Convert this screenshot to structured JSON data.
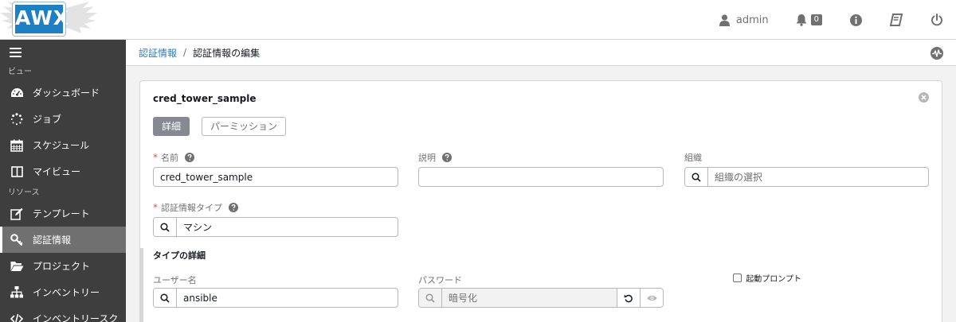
{
  "header": {
    "logo_text": "AWX",
    "user": "admin",
    "notification_count": "0"
  },
  "sidebar": {
    "section_views": "ビュー",
    "section_resources": "リソース",
    "items": [
      {
        "label": "ダッシュボード",
        "icon": "dashboard-icon"
      },
      {
        "label": "ジョブ",
        "icon": "jobs-spinner-icon"
      },
      {
        "label": "スケジュール",
        "icon": "calendar-icon"
      },
      {
        "label": "マイビュー",
        "icon": "columns-icon"
      },
      {
        "label": "テンプレート",
        "icon": "edit-icon"
      },
      {
        "label": "認証情報",
        "icon": "key-icon",
        "active": true
      },
      {
        "label": "プロジェクト",
        "icon": "folder-icon"
      },
      {
        "label": "インベントリー",
        "icon": "sitemap-icon"
      },
      {
        "label": "インベントリースク",
        "icon": "code-icon"
      }
    ]
  },
  "breadcrumb": {
    "parent": "認証情報",
    "separator": "/",
    "current": "認証情報の編集"
  },
  "panel": {
    "title": "cred_tower_sample",
    "tabs": [
      {
        "label": "詳細",
        "active": true
      },
      {
        "label": "パーミッション",
        "active": false
      }
    ],
    "fields": {
      "name_label": "名前",
      "name_value": "cred_tower_sample",
      "description_label": "説明",
      "description_value": "",
      "organization_label": "組織",
      "organization_placeholder": "組織の選択",
      "credential_type_label": "認証情報タイプ",
      "credential_type_value": "マシン"
    },
    "type_details": {
      "heading": "タイプの詳細",
      "username_label": "ユーザー名",
      "username_value": "ansible",
      "password_label": "パスワード",
      "password_value": "暗号化",
      "prompt_on_launch_label": "起動プロンプト"
    }
  },
  "colors": {
    "sidebar_bg": "#3e3e3e",
    "sidebar_active": "#707070",
    "link": "#337ab7",
    "required": "#d9534f",
    "logo_blue": "#1d7fc4"
  }
}
